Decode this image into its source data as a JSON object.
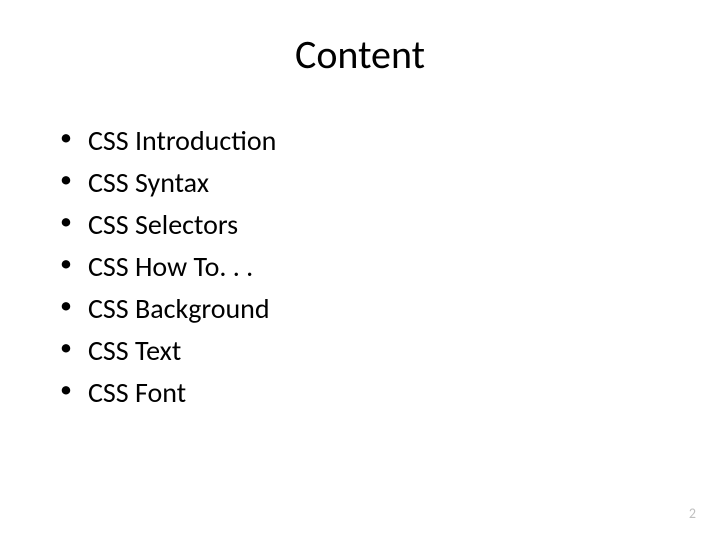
{
  "title": "Content",
  "items": [
    "CSS Introduction",
    "CSS Syntax",
    "CSS Selectors",
    "CSS How To. . .",
    "CSS Background",
    "CSS Text",
    "CSS Font"
  ],
  "page_number": "2"
}
